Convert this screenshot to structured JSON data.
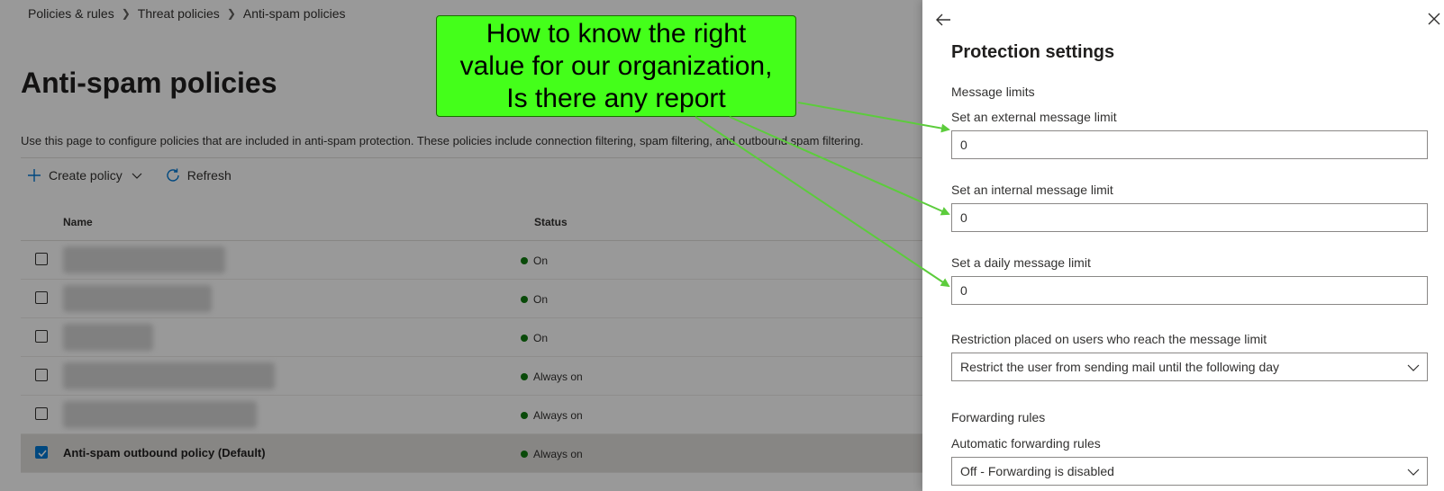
{
  "breadcrumb": [
    "Policies & rules",
    "Threat policies",
    "Anti-spam policies"
  ],
  "page": {
    "title": "Anti-spam policies",
    "description": "Use this page to configure policies that are included in anti-spam protection. These policies include connection filtering, spam filtering, and outbound spam filtering."
  },
  "toolbar": {
    "create_label": "Create policy",
    "refresh_label": "Refresh"
  },
  "table": {
    "headers": {
      "name": "Name",
      "status": "Status"
    },
    "rows": [
      {
        "name": "",
        "status": "On",
        "checked": false
      },
      {
        "name": "",
        "status": "On",
        "checked": false
      },
      {
        "name": "",
        "status": "On",
        "checked": false
      },
      {
        "name": "",
        "status": "Always on",
        "checked": false
      },
      {
        "name": "",
        "status": "Always on",
        "checked": false
      },
      {
        "name": "Anti-spam outbound policy (Default)",
        "status": "Always on",
        "checked": true
      }
    ]
  },
  "panel": {
    "title": "Protection settings",
    "message_limits_heading": "Message limits",
    "external_label": "Set an external message limit",
    "external_value": "0",
    "internal_label": "Set an internal message limit",
    "internal_value": "0",
    "daily_label": "Set a daily message limit",
    "daily_value": "0",
    "restriction_label": "Restriction placed on users who reach the message limit",
    "restriction_value": "Restrict the user from sending mail until the following day",
    "forwarding_heading": "Forwarding rules",
    "auto_forwarding_label": "Automatic forwarding rules",
    "auto_forwarding_value": "Off - Forwarding is disabled"
  },
  "annotation": {
    "lines": [
      "How to know the right",
      "value for our organization,",
      "Is there any report"
    ]
  },
  "colors": {
    "accent": "#0078d4",
    "status_green": "#107c10",
    "callout_green": "#44ff1a",
    "arrow_green": "#5ccc3c"
  }
}
